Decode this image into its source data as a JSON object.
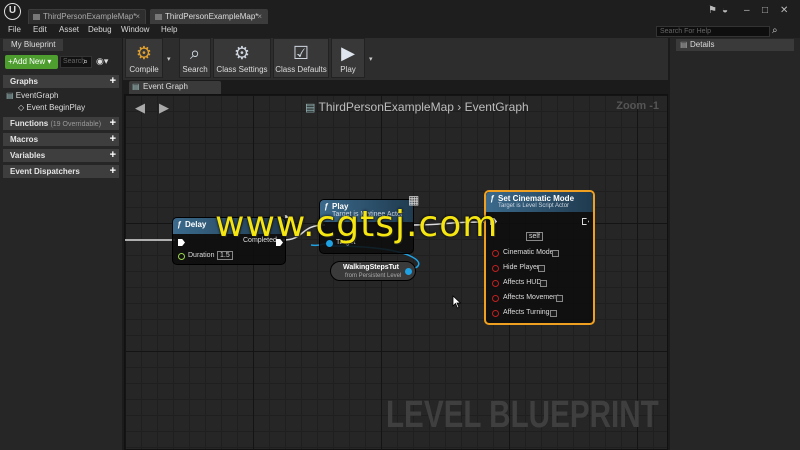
{
  "window": {
    "tabs": [
      {
        "label": "ThirdPersonExampleMap*",
        "active": false
      },
      {
        "label": "ThirdPersonExampleMap*",
        "active": true
      }
    ]
  },
  "menu": [
    "File",
    "Edit",
    "Asset",
    "Debug",
    "Window",
    "Help"
  ],
  "help_search": {
    "placeholder": "Search For Help"
  },
  "left_panel": {
    "tab_label": "My Blueprint",
    "add_new_label": "+Add New ▾",
    "search_placeholder": "Search",
    "graphs_label": "Graphs",
    "event_graph_label": "EventGraph",
    "event_beginplay_label": "Event BeginPlay",
    "functions_label": "Functions",
    "functions_sub": "(19 Overridable)",
    "macros_label": "Macros",
    "variables_label": "Variables",
    "dispatchers_label": "Event Dispatchers"
  },
  "toolbar": {
    "compile": "Compile",
    "search": "Search",
    "class_settings": "Class Settings",
    "class_defaults": "Class Defaults",
    "play": "Play"
  },
  "graph_tab": "Event Graph",
  "graph": {
    "breadcrumb_map": "ThirdPersonExampleMap",
    "breadcrumb_sep": "›",
    "breadcrumb_graph": "EventGraph",
    "zoom": "Zoom -1",
    "watermark": "LEVEL BLUEPRINT"
  },
  "nodes": {
    "delay": {
      "title": "Delay",
      "completed": "Completed",
      "duration_label": "Duration",
      "duration_value": "1.5"
    },
    "play": {
      "title": "Play",
      "subtitle": "Target is Matinee Actor",
      "target": "Target"
    },
    "walking": {
      "title": "WalkingStepsTut",
      "subtitle": "from Persistent Level"
    },
    "cinematic": {
      "title": "Set Cinematic Mode",
      "subtitle": "Target is Level Script Actor",
      "target_value": "self",
      "pins": [
        "Cinematic Mode",
        "Hide Player",
        "Affects HUD",
        "Affects Movement",
        "Affects Turning"
      ]
    }
  },
  "right_panel": {
    "tab_label": "Details"
  },
  "overlay_watermark": "www.cgtsj.com",
  "colors": {
    "function_header": "#3b6a8c",
    "selection": "#f0a020",
    "exec_wire": "#ffffff",
    "object_pin": "#1fa2e4",
    "bool_pin": "#8c0000"
  }
}
